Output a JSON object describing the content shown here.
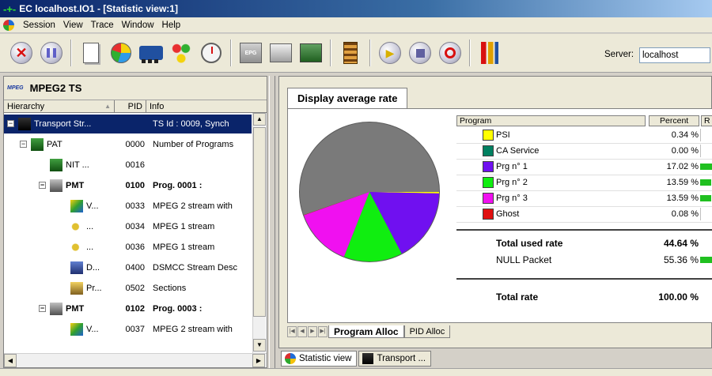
{
  "window": {
    "title": "EC localhost.IO1 - [Statistic view:1]"
  },
  "menu": [
    "Session",
    "View",
    "Trace",
    "Window",
    "Help"
  ],
  "toolbar": {
    "buttons": [
      "stop-icon",
      "pause-icon",
      "document-icon",
      "pie-chart-icon",
      "train-icon",
      "tree-icon",
      "stopwatch-icon",
      "epg-icon",
      "mail-icon",
      "screen-icon",
      "film-icon",
      "play-icon",
      "stop-square-icon",
      "record-icon",
      "tools-icon"
    ],
    "epg_label": "EPG",
    "server_label": "Server:",
    "server_value": "localhost"
  },
  "left": {
    "title": "MPEG2 TS",
    "badge": "MPEG",
    "columns": {
      "hierarchy": "Hierarchy",
      "pid": "PID",
      "info": "Info"
    },
    "rows": [
      {
        "name": "Transport Str...",
        "pid": "",
        "info": "TS Id : 0009, Synch",
        "level": 0,
        "expander": "−",
        "icon": "ts",
        "bold": false,
        "selected": true
      },
      {
        "name": "PAT",
        "pid": "0000",
        "info": "Number of Programs",
        "level": 1,
        "expander": "−",
        "icon": "pat",
        "bold": false,
        "selected": false
      },
      {
        "name": "NIT ...",
        "pid": "0016",
        "info": "",
        "level": 2,
        "expander": "",
        "icon": "pat",
        "bold": false,
        "selected": false
      },
      {
        "name": "PMT",
        "pid": "0100",
        "info": "Prog. 0001 :",
        "level": 2,
        "expander": "−",
        "icon": "pmt",
        "bold": true,
        "selected": false
      },
      {
        "name": "V...",
        "pid": "0033",
        "info": "MPEG 2 stream with",
        "level": 3,
        "expander": "",
        "icon": "video",
        "bold": false,
        "selected": false
      },
      {
        "name": "...",
        "pid": "0034",
        "info": "MPEG 1 stream",
        "level": 3,
        "expander": "",
        "icon": "audio",
        "bold": false,
        "selected": false
      },
      {
        "name": "...",
        "pid": "0036",
        "info": "MPEG 1 stream",
        "level": 3,
        "expander": "",
        "icon": "audio",
        "bold": false,
        "selected": false
      },
      {
        "name": "D...",
        "pid": "0400",
        "info": "DSMCC Stream Desc",
        "level": 3,
        "expander": "",
        "icon": "dsm",
        "bold": false,
        "selected": false
      },
      {
        "name": "Pr...",
        "pid": "0502",
        "info": "Sections",
        "level": 3,
        "expander": "",
        "icon": "priv",
        "bold": false,
        "selected": false
      },
      {
        "name": "PMT",
        "pid": "0102",
        "info": "Prog. 0003 :",
        "level": 2,
        "expander": "−",
        "icon": "pmt",
        "bold": true,
        "selected": false
      },
      {
        "name": "V...",
        "pid": "0037",
        "info": "MPEG 2 stream with",
        "level": 3,
        "expander": "",
        "icon": "video",
        "bold": false,
        "selected": false
      }
    ]
  },
  "right": {
    "tab_title": "Display average rate",
    "legend_headers": {
      "program": "Program",
      "percent": "Percent",
      "r": "R"
    },
    "programs": [
      {
        "name": "PSI",
        "percent": "0.34 %",
        "value": 0.34,
        "color": "#ffff00"
      },
      {
        "name": "CA Service",
        "percent": "0.00 %",
        "value": 0.0,
        "color": "#008060"
      },
      {
        "name": "Prg n° 1",
        "percent": "17.02 %",
        "value": 17.02,
        "color": "#7010f0"
      },
      {
        "name": "Prg n° 2",
        "percent": "13.59 %",
        "value": 13.59,
        "color": "#10ee10"
      },
      {
        "name": "Prg n° 3",
        "percent": "13.59 %",
        "value": 13.59,
        "color": "#f010f0"
      },
      {
        "name": "Ghost",
        "percent": "0.08 %",
        "value": 0.08,
        "color": "#e01010"
      }
    ],
    "total_used": {
      "label": "Total used rate",
      "percent": "44.64 %"
    },
    "null_packet": {
      "label": "NULL Packet",
      "percent": "55.36 %",
      "value": 55.36
    },
    "total": {
      "label": "Total rate",
      "percent": "100.00 %",
      "value": 100.0
    },
    "subtabs": [
      "Program Alloc",
      "PID Alloc"
    ],
    "doc_tabs": [
      "Statistic view",
      "Transport ..."
    ]
  },
  "colors": {
    "null_slice": "#7a7a7a",
    "null_rim": "#5a5a5a",
    "bar": "#20c020",
    "selection": "#0a246a"
  },
  "chart_data": {
    "type": "pie",
    "categories": [
      "PSI",
      "CA Service",
      "Prg n° 1",
      "Prg n° 2",
      "Prg n° 3",
      "Ghost",
      "NULL Packet"
    ],
    "values": [
      0.34,
      0.0,
      17.02,
      13.59,
      13.59,
      0.08,
      55.36
    ],
    "colors": [
      "#ffff00",
      "#008060",
      "#7010f0",
      "#10ee10",
      "#f010f0",
      "#e01010",
      "#7a7a7a"
    ]
  }
}
